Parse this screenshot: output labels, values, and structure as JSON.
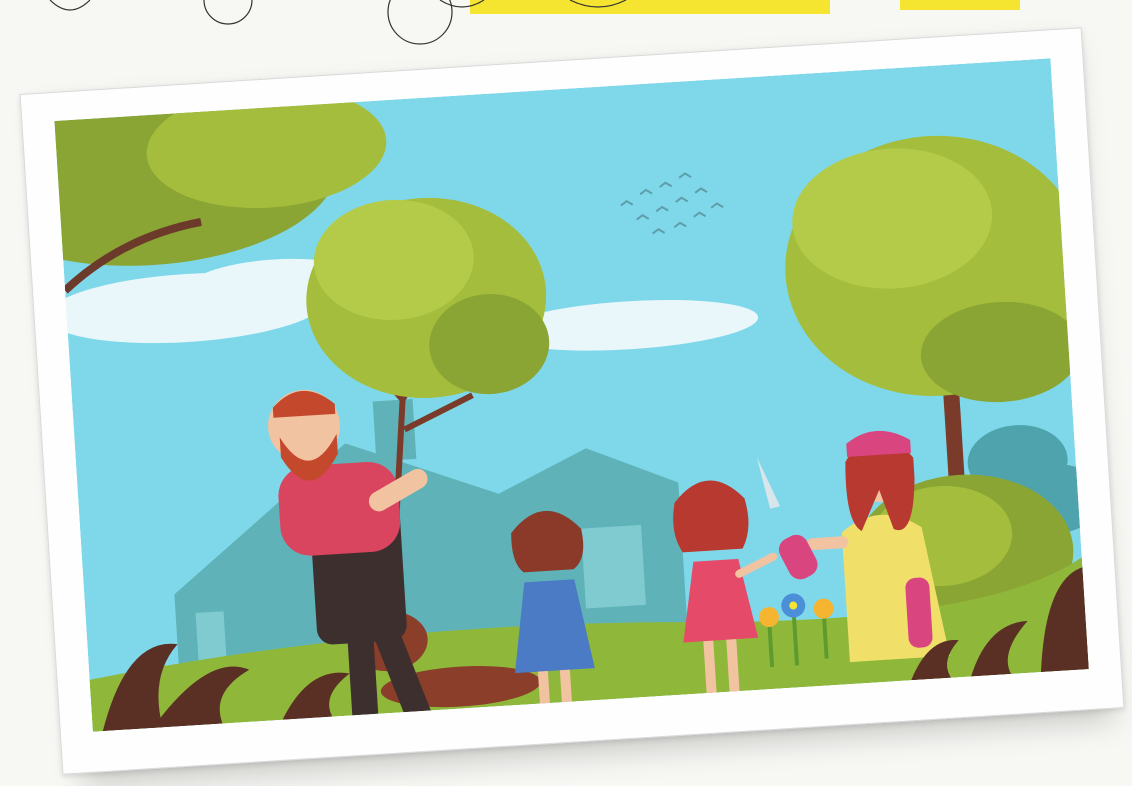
{
  "scene": {
    "subject": "family-gardening",
    "colors": {
      "sky": "#7fd8ea",
      "sky_top": "#8fdff0",
      "cloud": "#e9f7fa",
      "house": "#5fb3b8",
      "grass": "#8fb83a",
      "dark_leaves": "#5a2f24",
      "tree_leaf": "#a4bd3c",
      "tree_leaf_dark": "#8aa534",
      "soil": "#8b3e2a",
      "highlight_yellow": "#f5e531"
    }
  }
}
